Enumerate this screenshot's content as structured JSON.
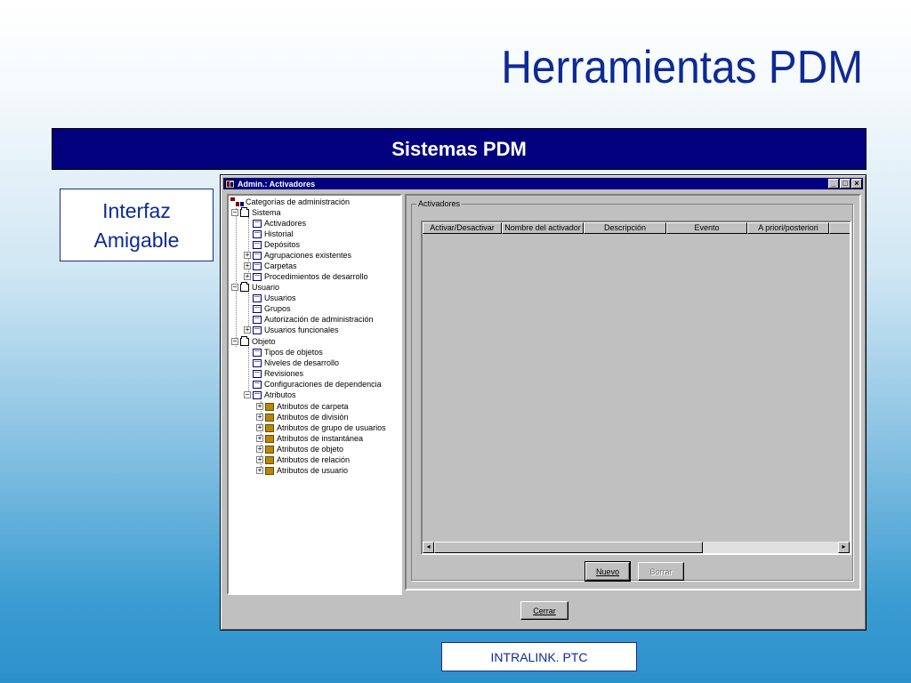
{
  "slide": {
    "title": "Herramientas PDM",
    "banner": "Sistemas PDM",
    "side_box_line1": "Interfaz",
    "side_box_line2": "Amigable",
    "footer": "INTRALINK. PTC"
  },
  "window": {
    "title": "Admin.: Activadores",
    "controls": {
      "minimize": "_",
      "maximize": "□",
      "close": "×"
    }
  },
  "tree": {
    "root": "Categorías de administración",
    "sistema": "Sistema",
    "sistema_items": [
      "Activadores",
      "Historial",
      "Depósitos",
      "Agrupaciones existentes",
      "Carpetas",
      "Procedimientos de desarrollo"
    ],
    "usuario": "Usuario",
    "usuario_items": [
      "Usuarios",
      "Grupos",
      "Autorización de administración",
      "Usuarios funcionales"
    ],
    "objeto": "Objeto",
    "objeto_items": [
      "Tipos de objetos",
      "Niveles de desarrollo",
      "Revisiones",
      "Configuraciones de dependencia",
      "Atributos"
    ],
    "atributos_items": [
      "Atributos de carpeta",
      "Atributos de división",
      "Atributos de grupo de usuarios",
      "Atributos de instantánea",
      "Atributos de objeto",
      "Atributos de relación",
      "Atributos de usuario"
    ]
  },
  "panel": {
    "group_label": "Activadores",
    "columns": [
      "Activar/Desactivar",
      "Nombre del activador",
      "Descripción",
      "Evento",
      "A priori/posteriori",
      "("
    ],
    "scroll_left": "◂",
    "scroll_right": "▸",
    "new_button": "Nuevo",
    "delete_button": "Borrar"
  },
  "footer_button": "Cerrar"
}
